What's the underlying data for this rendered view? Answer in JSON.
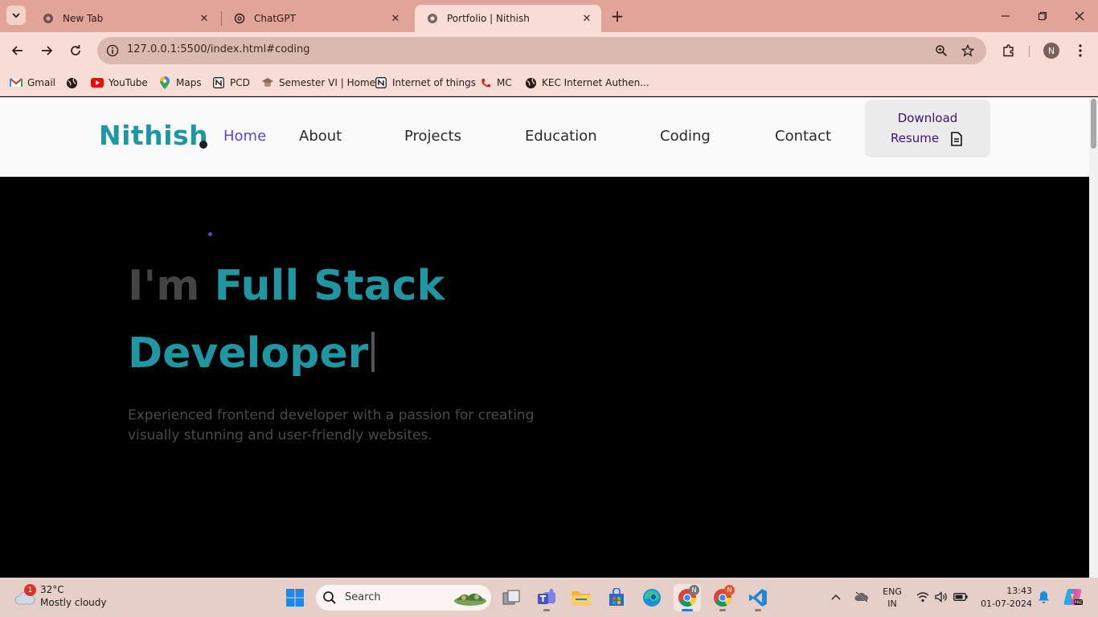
{
  "browser": {
    "tabs": [
      {
        "title": "New Tab",
        "icon": "chrome-icon"
      },
      {
        "title": "ChatGPT",
        "icon": "chatgpt-icon"
      },
      {
        "title": "Portfolio | Nithish",
        "icon": "globe-icon",
        "active": true
      }
    ],
    "url": "127.0.0.1:5500/index.html#coding",
    "profile_initial": "N",
    "bookmarks": [
      {
        "label": "Gmail",
        "icon": "gmail-icon"
      },
      {
        "label": "",
        "icon": "globe-icon"
      },
      {
        "label": "YouTube",
        "icon": "youtube-icon"
      },
      {
        "label": "Maps",
        "icon": "maps-icon"
      },
      {
        "label": "PCD",
        "icon": "notion-icon"
      },
      {
        "label": "Semester VI | Home",
        "icon": "cap-icon"
      },
      {
        "label": "Internet of things",
        "icon": "notion-icon"
      },
      {
        "label": "MC",
        "icon": "phone-icon"
      },
      {
        "label": "KEC Internet Authen...",
        "icon": "globe-icon"
      }
    ],
    "theme_color": "#e0a598"
  },
  "site": {
    "logo": "Nithish",
    "nav": [
      "Home",
      "About",
      "Projects",
      "Education",
      "Coding",
      "Contact"
    ],
    "active_nav": "Home",
    "resume_line1": "Download",
    "resume_line2": "Resume",
    "hero_prefix": "I'm",
    "hero_highlight": "Full Stack",
    "hero_line2": "Developer",
    "hero_desc": "Experienced frontend developer with a passion for creating visually stunning and user-friendly websites.",
    "accent_color": "#1f97a3",
    "active_color": "#5a45d6"
  },
  "taskbar": {
    "weather_temp": "32°C",
    "weather_cond": "Mostly cloudy",
    "weather_badge": "1",
    "search_placeholder": "Search",
    "lang_line1": "ENG",
    "lang_line2": "IN",
    "time": "13:43",
    "date": "01-07-2024",
    "chrome_badge": "N"
  }
}
